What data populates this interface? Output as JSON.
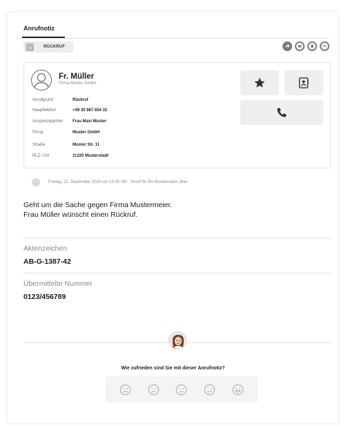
{
  "tabs": [
    {
      "label": "Anrufnotiz",
      "active": true
    }
  ],
  "toolbar": {
    "badge_label": "RÜCKRUF"
  },
  "contact": {
    "name": "Fr. Müller",
    "company": "Firma Muster GmbH",
    "fields": [
      {
        "label": "Anrufgrund",
        "value": "Rückruf"
      },
      {
        "label": "Haupttelefon",
        "value": "+49 30 987 654 32"
      },
      {
        "label": "Ansprechpartner",
        "value": "Frau Maxi Muster"
      },
      {
        "label": "Firma",
        "value": "Muster GmbH"
      },
      {
        "label": "Straße",
        "value": "Muster Str. 11"
      },
      {
        "label": "PLZ / Ort",
        "value": "11220 Musterstadt"
      }
    ]
  },
  "timeline": {
    "text": "Freitag, 22. September 2024 um 15:00 Uhr · Anruf für RA Mustermann, Max"
  },
  "note": {
    "line1": "Geht um die Sache gegen Firma Mustermeier.",
    "line2": "Frau Müller wünscht einen Rückruf."
  },
  "aktenzeichen": {
    "label": "Aktenzeichen",
    "value": "AB-G-1387-42"
  },
  "nummer": {
    "label": "Übermittelte Nummer",
    "value": "0123/456789"
  },
  "feedback": {
    "question": "Wie zufrieden sind Sie mit dieser Anrufnotiz?"
  },
  "icons": {
    "toolbar": [
      "forward-icon",
      "print-icon",
      "archive-icon",
      "redo-icon"
    ],
    "ratings": [
      "very-unhappy-icon",
      "unhappy-icon",
      "neutral-icon",
      "happy-icon",
      "very-happy-icon"
    ]
  },
  "colors": {
    "icon_gray": "#7b7b7b",
    "button_bg": "#efefef"
  }
}
